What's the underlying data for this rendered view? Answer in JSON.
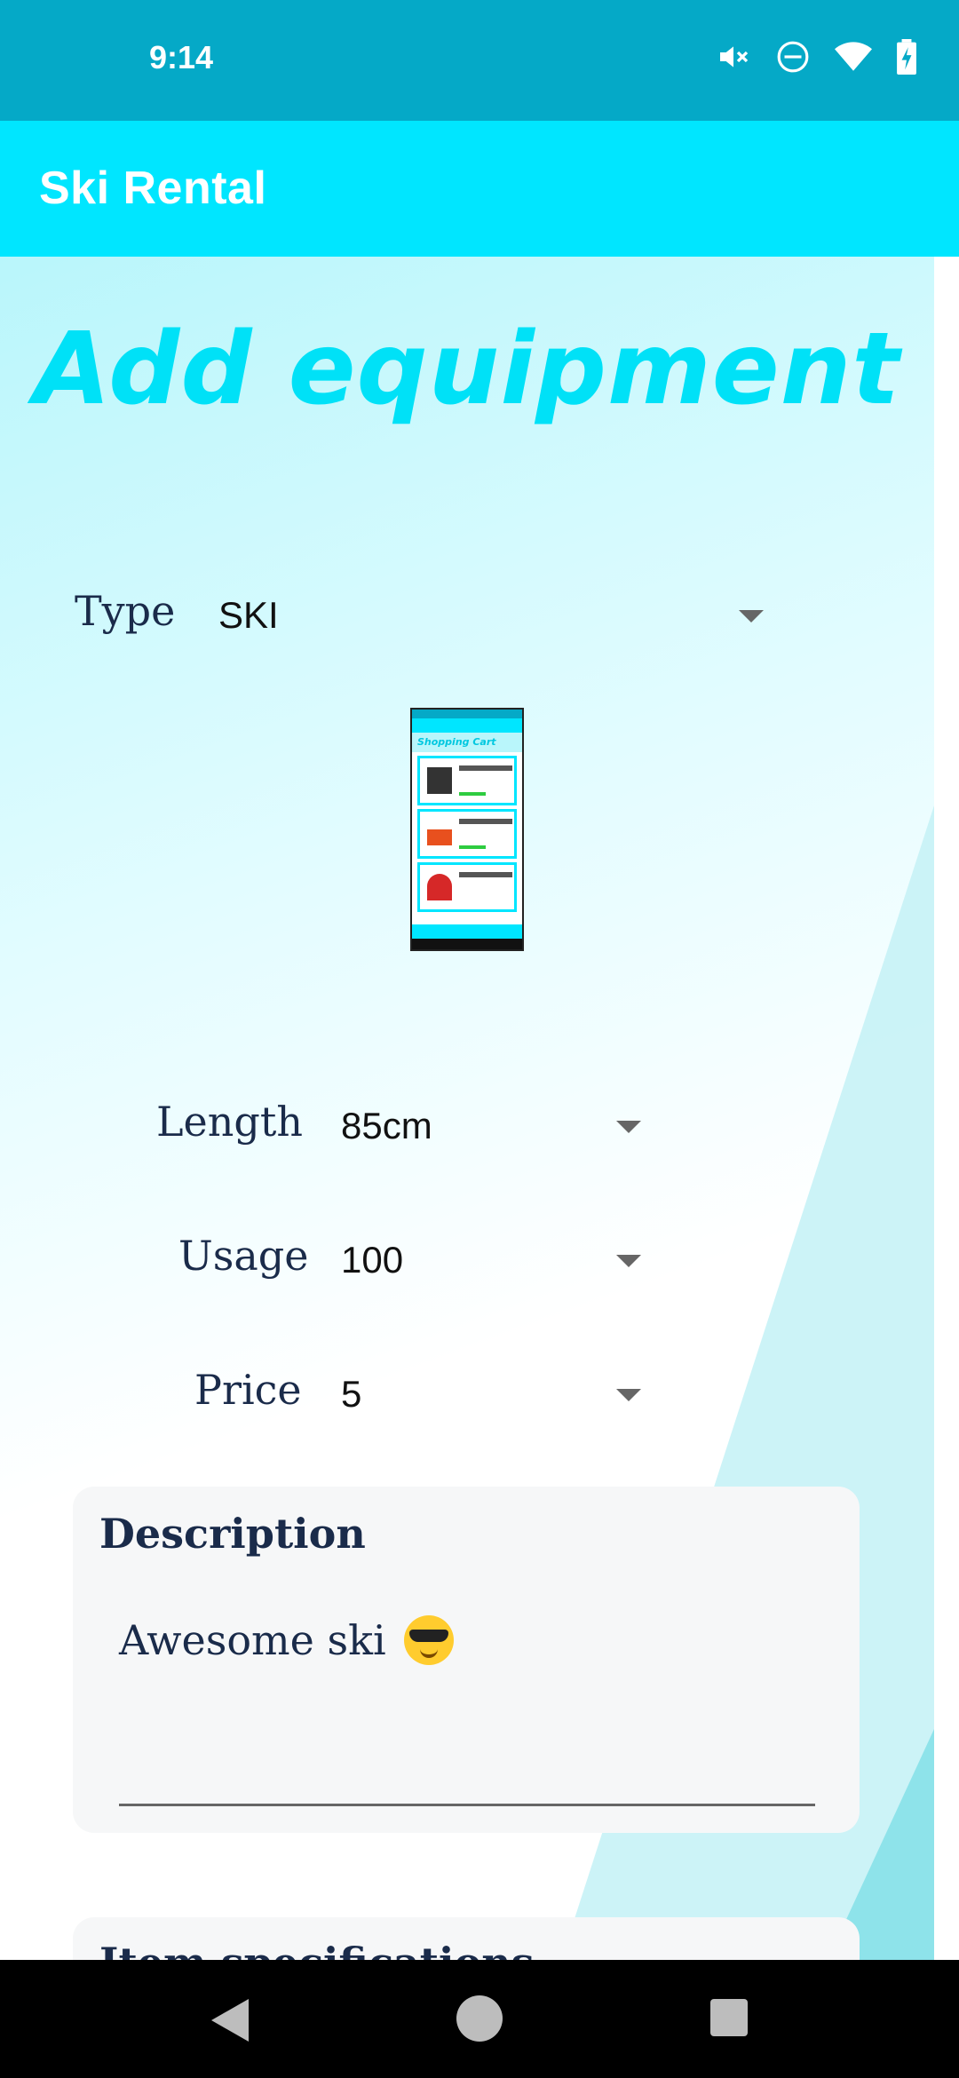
{
  "status_bar": {
    "time": "9:14",
    "icons": [
      "mute-icon",
      "do-not-disturb-icon",
      "wifi-icon",
      "battery-charging-icon"
    ]
  },
  "app_bar": {
    "title": "Ski Rental"
  },
  "page": {
    "heading": "Add equipment"
  },
  "form": {
    "type": {
      "label": "Type",
      "value": "SKI"
    },
    "length": {
      "label": "Length",
      "value": "85cm"
    },
    "usage": {
      "label": "Usage",
      "value": "100"
    },
    "price": {
      "label": "Price",
      "value": "5"
    },
    "description": {
      "title": "Description",
      "value": "Awesome ski"
    },
    "specifications": {
      "title": "Item specifications"
    }
  },
  "colors": {
    "accent": "#00e6ff",
    "status_bar": "#05a9c7",
    "label_text": "#1a2b4a"
  }
}
